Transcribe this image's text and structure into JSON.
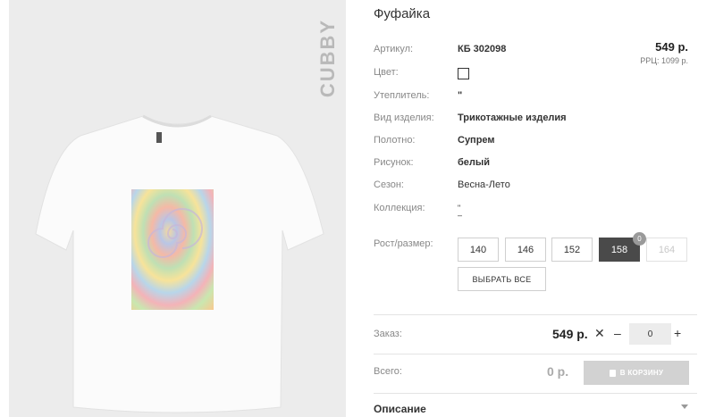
{
  "product": {
    "title": "Фуфайка",
    "brand": "CUBBY",
    "price": "549 р.",
    "rrp": "РРЦ: 1099 р."
  },
  "attributes": {
    "article": {
      "label": "Артикул:",
      "value": "КБ 302098"
    },
    "color": {
      "label": "Цвет:"
    },
    "insulation": {
      "label": "Утеплитель:",
      "value": "\""
    },
    "product_type": {
      "label": "Вид изделия:",
      "value": "Трикотажные изделия"
    },
    "fabric": {
      "label": "Полотно:",
      "value": "Супрем"
    },
    "pattern": {
      "label": "Рисунок:",
      "value": "белый"
    },
    "season": {
      "label": "Сезон:",
      "value": "Весна-Лето"
    },
    "collection": {
      "label": "Коллекция:",
      "value_top": "\"",
      "value_bottom": "–"
    }
  },
  "sizes": {
    "label": "Рост/размер:",
    "items": [
      {
        "label": "140",
        "state": "normal"
      },
      {
        "label": "146",
        "state": "normal"
      },
      {
        "label": "152",
        "state": "normal"
      },
      {
        "label": "158",
        "state": "selected"
      },
      {
        "label": "164",
        "state": "disabled"
      }
    ],
    "selected_count": "0",
    "select_all_label": "ВЫБРАТЬ ВСЕ"
  },
  "order": {
    "label": "Заказ:",
    "price": "549 р.",
    "times_symbol": "✕",
    "minus_symbol": "–",
    "quantity": "0",
    "plus_symbol": "+"
  },
  "total": {
    "label": "Всего:",
    "value": "0 р.",
    "cart_button_label": "В КОРЗИНУ"
  },
  "description": {
    "label": "Описание"
  },
  "colors": {
    "photo_bg": "#ececec",
    "selected_size": "#4a4a4a",
    "cart_button": "#d2d2d2"
  },
  "icons": [
    "bag-icon",
    "chevron-down-icon",
    "close-icon",
    "minus-icon",
    "plus-icon"
  ]
}
